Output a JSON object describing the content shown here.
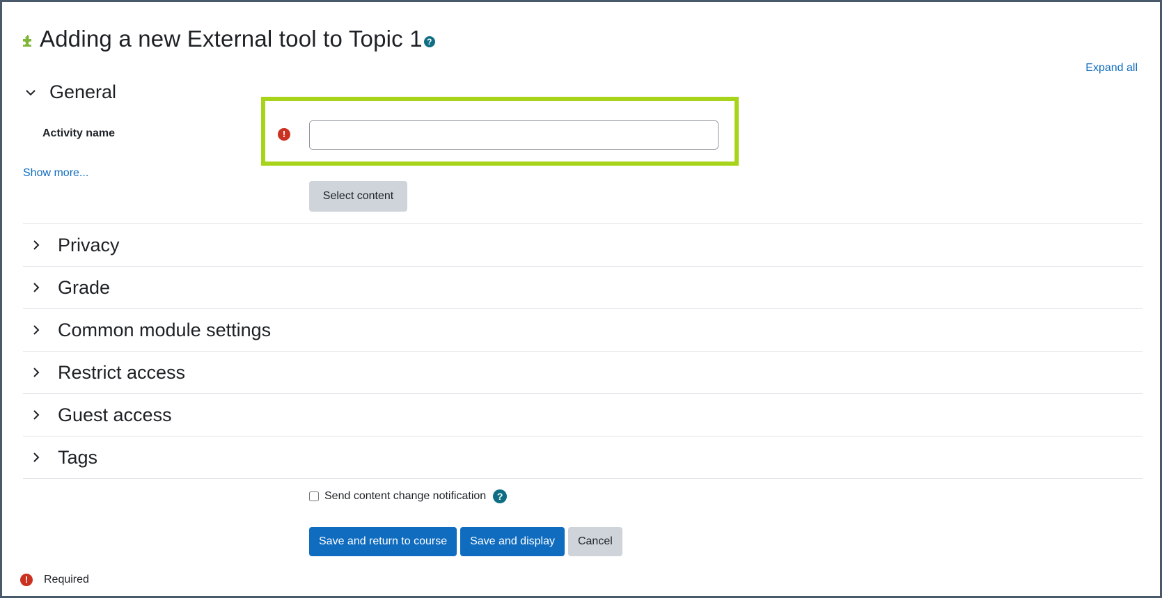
{
  "page": {
    "title": "Adding a new External tool to Topic 1",
    "expand_all": "Expand all"
  },
  "general": {
    "title": "General",
    "activity_name_label": "Activity name",
    "activity_name_value": "",
    "show_more": "Show more...",
    "select_content": "Select content"
  },
  "sections": [
    {
      "title": "Privacy"
    },
    {
      "title": "Grade"
    },
    {
      "title": "Common module settings"
    },
    {
      "title": "Restrict access"
    },
    {
      "title": "Guest access"
    },
    {
      "title": "Tags"
    }
  ],
  "footer": {
    "notify_label": "Send content change notification",
    "notify_checked": false,
    "save_return": "Save and return to course",
    "save_display": "Save and display",
    "cancel": "Cancel",
    "required": "Required"
  },
  "colors": {
    "primary": "#0f6cbf",
    "required": "#ca3120",
    "help": "#0f6e84",
    "highlight": "#a7d41a",
    "puzzle": "#7fb539"
  }
}
